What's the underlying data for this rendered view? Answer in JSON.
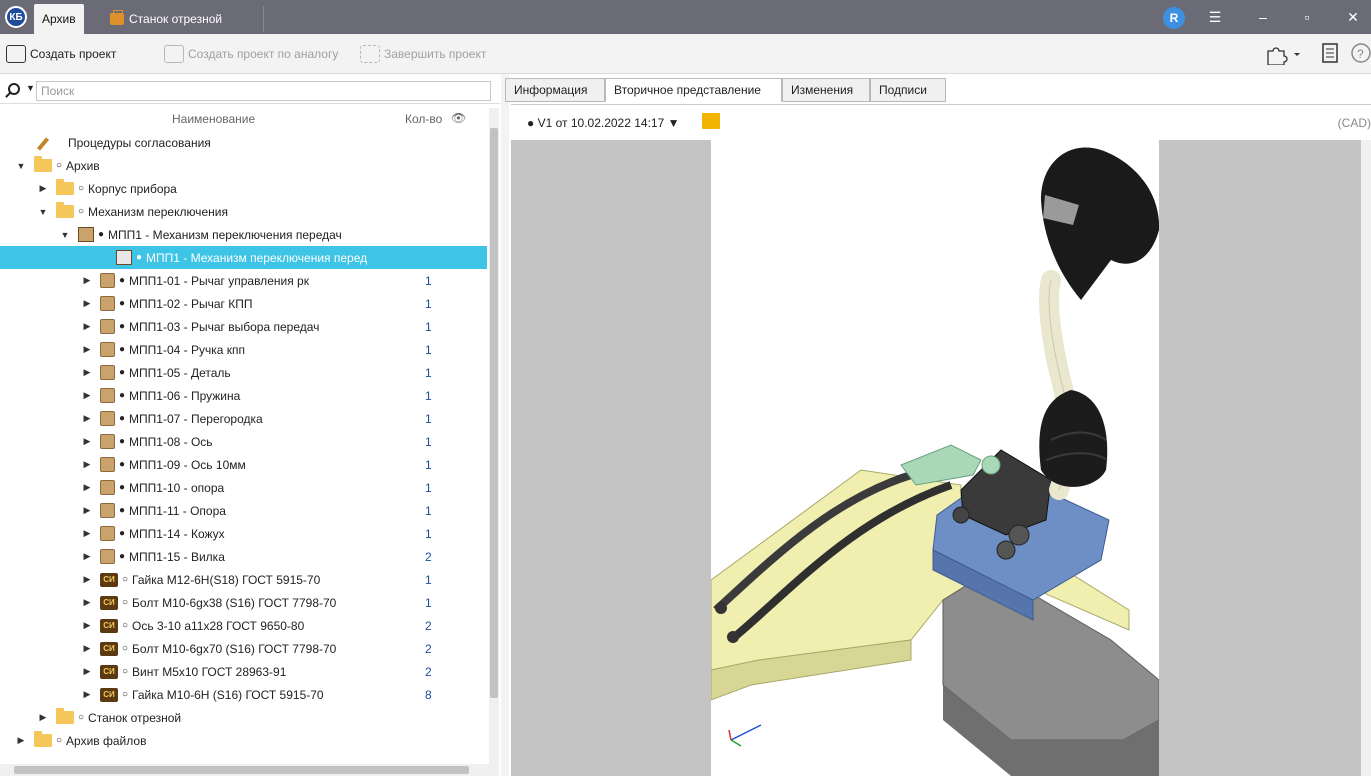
{
  "window": {
    "logo": "КБ",
    "tabs": [
      {
        "label": "Архив"
      },
      {
        "label": "Станок отрезной"
      }
    ],
    "user_initial": "R"
  },
  "toolbar": {
    "create_project": "Создать проект",
    "create_by_analogy": "Создать проект по аналогу",
    "finish_project": "Завершить проект"
  },
  "search": {
    "placeholder": "Поиск"
  },
  "tree_header": {
    "name": "Наименование",
    "qty": "Кол-во"
  },
  "tree": {
    "approval": "Процедуры согласования",
    "archive": "Архив",
    "body": "Корпус прибора",
    "mechanism": "Механизм переключения",
    "mpp1": "МПП1 - Механизм переключения передач",
    "mpp1_selected": "МПП1 - Механизм переключения перед",
    "items": [
      {
        "label": "МПП1-01 - Рычаг управления рк",
        "qty": "1"
      },
      {
        "label": "МПП1-02 - Рычаг КПП",
        "qty": "1"
      },
      {
        "label": "МПП1-03 - Рычаг выбора передач",
        "qty": "1"
      },
      {
        "label": "МПП1-04 - Ручка кпп",
        "qty": "1"
      },
      {
        "label": "МПП1-05 - Деталь",
        "qty": "1"
      },
      {
        "label": "МПП1-06 - Пружина",
        "qty": "1"
      },
      {
        "label": "МПП1-07 - Перегородка",
        "qty": "1"
      },
      {
        "label": "МПП1-08 - Ось",
        "qty": "1"
      },
      {
        "label": "МПП1-09 - Ось 10мм",
        "qty": "1"
      },
      {
        "label": "МПП1-10 - опора",
        "qty": "1"
      },
      {
        "label": "МПП1-11 - Опора",
        "qty": "1"
      },
      {
        "label": "МПП1-14 - Кожух",
        "qty": "1"
      },
      {
        "label": "МПП1-15 - Вилка",
        "qty": "2"
      }
    ],
    "std_items": [
      {
        "label": "Гайка М12-6Н(S18) ГОСТ 5915-70",
        "qty": "1"
      },
      {
        "label": "Болт М10-6gх38 (S16) ГОСТ 7798-70",
        "qty": "1"
      },
      {
        "label": "Ось 3-10 а11х28 ГОСТ 9650-80",
        "qty": "2"
      },
      {
        "label": "Болт М10-6gх70 (S16) ГОСТ 7798-70",
        "qty": "2"
      },
      {
        "label": "Винт М5х10 ГОСТ 28963-91",
        "qty": "2"
      },
      {
        "label": "Гайка М10-6Н (S16) ГОСТ 5915-70",
        "qty": "8"
      }
    ],
    "std_badge": "СИ",
    "machine": "Станок отрезной",
    "files": "Архив файлов"
  },
  "right_tabs": [
    "Информация",
    "Вторичное представление",
    "Изменения",
    "Подписи"
  ],
  "version": {
    "label": "V1 от 10.02.2022 14:17",
    "cad": "(CAD)"
  }
}
